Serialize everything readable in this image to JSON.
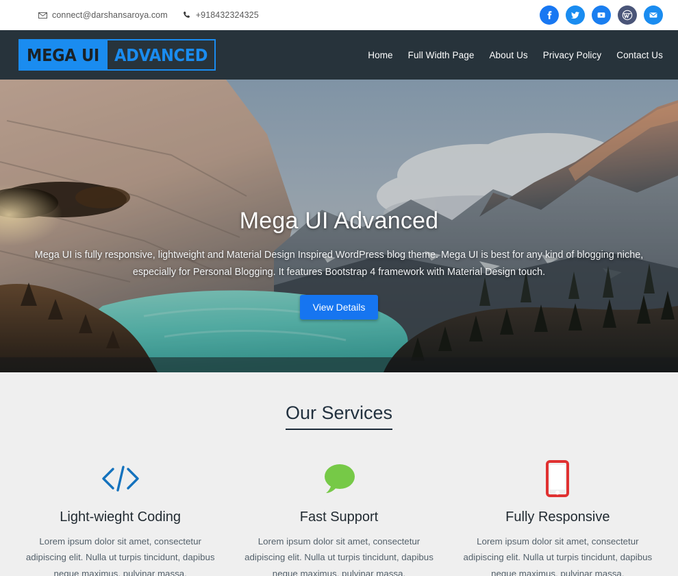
{
  "topbar": {
    "email": "connect@darshansaroya.com",
    "email_icon": "envelope-icon",
    "phone": "+918432324325",
    "phone_icon": "phone-icon",
    "socials": [
      {
        "name": "facebook",
        "label": "f",
        "color": "#1877f2"
      },
      {
        "name": "twitter",
        "label": "t",
        "color": "#1a8cf0"
      },
      {
        "name": "youtube",
        "label": "y",
        "color": "#1a7ef0"
      },
      {
        "name": "wordpress",
        "label": "w",
        "color": "#4a5578"
      },
      {
        "name": "email",
        "label": "e",
        "color": "#1a8cf0"
      }
    ]
  },
  "header": {
    "logo_part1": "Mega UI",
    "logo_part2": "Advanced",
    "logo_bg": "#1a8cf0",
    "header_bg": "#27333b",
    "nav": [
      {
        "label": "Home"
      },
      {
        "label": "Full Width Page"
      },
      {
        "label": "About Us"
      },
      {
        "label": "Privacy Policy"
      },
      {
        "label": "Contact Us"
      }
    ]
  },
  "hero": {
    "title": "Mega UI Advanced",
    "description": "Mega UI is fully responsive, lightweight and Material Design Inspired WordPress blog theme. Mega UI is best for any kind of blogging niche, especially for Personal Blogging. It features Bootstrap 4 framework with Material Design touch.",
    "button_label": "View Details",
    "button_color": "#1675f0",
    "image_alt": "mountain-landscape-turquoise-lake"
  },
  "services": {
    "heading": "Our Services",
    "background": "#efefef",
    "cards": [
      {
        "icon": "code-icon",
        "icon_color": "#1472bd",
        "title": "Light-wieght Coding",
        "text": "Lorem ipsum dolor sit amet, consectetur adipiscing elit. Nulla ut turpis tincidunt, dapibus neque maximus, pulvinar massa."
      },
      {
        "icon": "speech-bubble-icon",
        "icon_color": "#76c947",
        "title": "Fast Support",
        "text": "Lorem ipsum dolor sit amet, consectetur adipiscing elit. Nulla ut turpis tincidunt, dapibus neque maximus, pulvinar massa."
      },
      {
        "icon": "tablet-icon",
        "icon_color": "#e03131",
        "title": "Fully Responsive",
        "text": "Lorem ipsum dolor sit amet, consectetur adipiscing elit. Nulla ut turpis tincidunt, dapibus neque maximus, pulvinar massa."
      }
    ]
  }
}
